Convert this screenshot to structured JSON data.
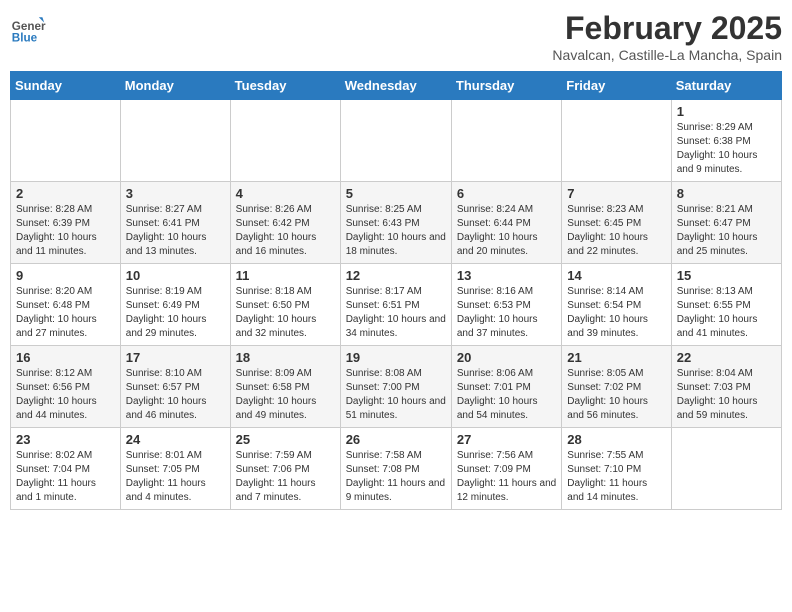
{
  "header": {
    "logo_general": "General",
    "logo_blue": "Blue",
    "month": "February 2025",
    "location": "Navalcan, Castille-La Mancha, Spain"
  },
  "days_of_week": [
    "Sunday",
    "Monday",
    "Tuesday",
    "Wednesday",
    "Thursday",
    "Friday",
    "Saturday"
  ],
  "weeks": [
    [
      {
        "day": "",
        "info": ""
      },
      {
        "day": "",
        "info": ""
      },
      {
        "day": "",
        "info": ""
      },
      {
        "day": "",
        "info": ""
      },
      {
        "day": "",
        "info": ""
      },
      {
        "day": "",
        "info": ""
      },
      {
        "day": "1",
        "info": "Sunrise: 8:29 AM\nSunset: 6:38 PM\nDaylight: 10 hours and 9 minutes."
      }
    ],
    [
      {
        "day": "2",
        "info": "Sunrise: 8:28 AM\nSunset: 6:39 PM\nDaylight: 10 hours and 11 minutes."
      },
      {
        "day": "3",
        "info": "Sunrise: 8:27 AM\nSunset: 6:41 PM\nDaylight: 10 hours and 13 minutes."
      },
      {
        "day": "4",
        "info": "Sunrise: 8:26 AM\nSunset: 6:42 PM\nDaylight: 10 hours and 16 minutes."
      },
      {
        "day": "5",
        "info": "Sunrise: 8:25 AM\nSunset: 6:43 PM\nDaylight: 10 hours and 18 minutes."
      },
      {
        "day": "6",
        "info": "Sunrise: 8:24 AM\nSunset: 6:44 PM\nDaylight: 10 hours and 20 minutes."
      },
      {
        "day": "7",
        "info": "Sunrise: 8:23 AM\nSunset: 6:45 PM\nDaylight: 10 hours and 22 minutes."
      },
      {
        "day": "8",
        "info": "Sunrise: 8:21 AM\nSunset: 6:47 PM\nDaylight: 10 hours and 25 minutes."
      }
    ],
    [
      {
        "day": "9",
        "info": "Sunrise: 8:20 AM\nSunset: 6:48 PM\nDaylight: 10 hours and 27 minutes."
      },
      {
        "day": "10",
        "info": "Sunrise: 8:19 AM\nSunset: 6:49 PM\nDaylight: 10 hours and 29 minutes."
      },
      {
        "day": "11",
        "info": "Sunrise: 8:18 AM\nSunset: 6:50 PM\nDaylight: 10 hours and 32 minutes."
      },
      {
        "day": "12",
        "info": "Sunrise: 8:17 AM\nSunset: 6:51 PM\nDaylight: 10 hours and 34 minutes."
      },
      {
        "day": "13",
        "info": "Sunrise: 8:16 AM\nSunset: 6:53 PM\nDaylight: 10 hours and 37 minutes."
      },
      {
        "day": "14",
        "info": "Sunrise: 8:14 AM\nSunset: 6:54 PM\nDaylight: 10 hours and 39 minutes."
      },
      {
        "day": "15",
        "info": "Sunrise: 8:13 AM\nSunset: 6:55 PM\nDaylight: 10 hours and 41 minutes."
      }
    ],
    [
      {
        "day": "16",
        "info": "Sunrise: 8:12 AM\nSunset: 6:56 PM\nDaylight: 10 hours and 44 minutes."
      },
      {
        "day": "17",
        "info": "Sunrise: 8:10 AM\nSunset: 6:57 PM\nDaylight: 10 hours and 46 minutes."
      },
      {
        "day": "18",
        "info": "Sunrise: 8:09 AM\nSunset: 6:58 PM\nDaylight: 10 hours and 49 minutes."
      },
      {
        "day": "19",
        "info": "Sunrise: 8:08 AM\nSunset: 7:00 PM\nDaylight: 10 hours and 51 minutes."
      },
      {
        "day": "20",
        "info": "Sunrise: 8:06 AM\nSunset: 7:01 PM\nDaylight: 10 hours and 54 minutes."
      },
      {
        "day": "21",
        "info": "Sunrise: 8:05 AM\nSunset: 7:02 PM\nDaylight: 10 hours and 56 minutes."
      },
      {
        "day": "22",
        "info": "Sunrise: 8:04 AM\nSunset: 7:03 PM\nDaylight: 10 hours and 59 minutes."
      }
    ],
    [
      {
        "day": "23",
        "info": "Sunrise: 8:02 AM\nSunset: 7:04 PM\nDaylight: 11 hours and 1 minute."
      },
      {
        "day": "24",
        "info": "Sunrise: 8:01 AM\nSunset: 7:05 PM\nDaylight: 11 hours and 4 minutes."
      },
      {
        "day": "25",
        "info": "Sunrise: 7:59 AM\nSunset: 7:06 PM\nDaylight: 11 hours and 7 minutes."
      },
      {
        "day": "26",
        "info": "Sunrise: 7:58 AM\nSunset: 7:08 PM\nDaylight: 11 hours and 9 minutes."
      },
      {
        "day": "27",
        "info": "Sunrise: 7:56 AM\nSunset: 7:09 PM\nDaylight: 11 hours and 12 minutes."
      },
      {
        "day": "28",
        "info": "Sunrise: 7:55 AM\nSunset: 7:10 PM\nDaylight: 11 hours and 14 minutes."
      },
      {
        "day": "",
        "info": ""
      }
    ]
  ]
}
